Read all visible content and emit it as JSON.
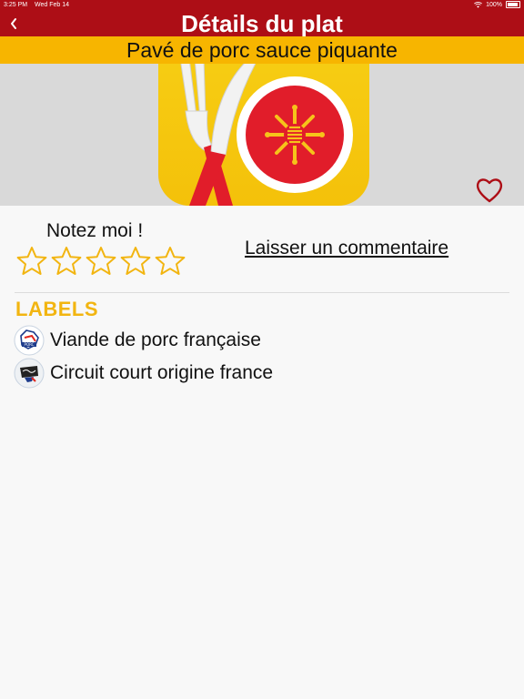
{
  "status_bar": {
    "time": "3:25 PM",
    "date": "Wed Feb 14",
    "battery": "100%"
  },
  "nav": {
    "title": "Détails du plat",
    "back_icon": "chevron-left-icon"
  },
  "dish": {
    "name": "Pavé de porc sauce piquante",
    "image_icon": "fork-knife-plate-occitan-cross-icon"
  },
  "rating": {
    "label": "Notez moi !",
    "max_stars": 5,
    "value": 0
  },
  "comment": {
    "label": "Laisser un commentaire"
  },
  "labels": {
    "heading": "LABELS",
    "items": [
      {
        "text": "Viande de porc française",
        "icon": "porc-francais-badge-icon"
      },
      {
        "text": "Circuit court origine france",
        "icon": "circuit-court-badge-icon"
      }
    ]
  },
  "colors": {
    "header": "#ad0e16",
    "banner": "#f7b500",
    "accent": "#f2b511",
    "star": "#f2b511"
  }
}
